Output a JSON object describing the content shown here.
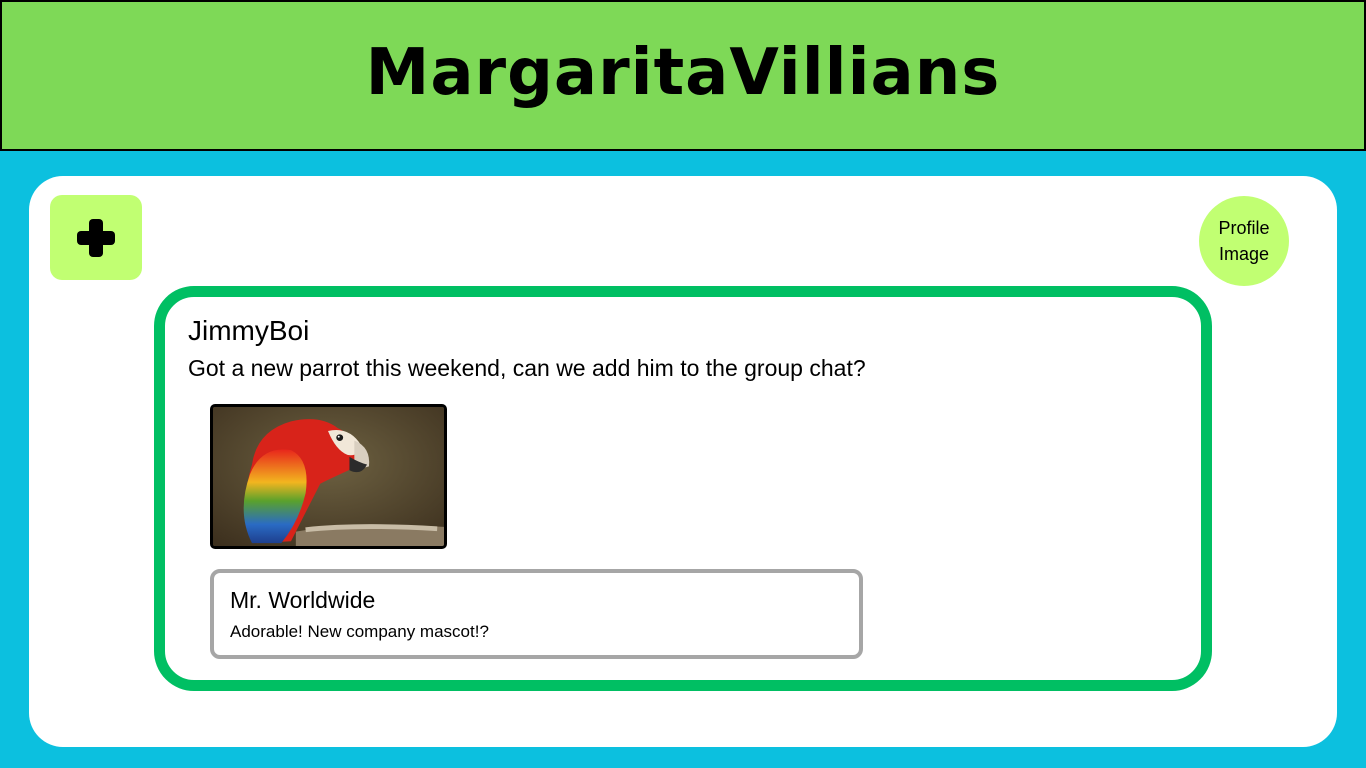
{
  "app": {
    "title": "MargaritaVillians"
  },
  "toolbar": {
    "add_button_icon": "plus-icon"
  },
  "profile": {
    "label": "Profile Image"
  },
  "post": {
    "author": "JimmyBoi",
    "text": "Got a new parrot this weekend, can we add him to the group chat?",
    "image_subject": "scarlet-macaw-parrot",
    "reply": {
      "author": "Mr. Worldwide",
      "text": "Adorable! New company mascot!?"
    }
  },
  "colors": {
    "header_bg": "#7ed957",
    "page_bg": "#0cc0df",
    "accent_lime": "#c1ff72",
    "post_border": "#00bf63",
    "reply_border": "#a6a6a6"
  }
}
